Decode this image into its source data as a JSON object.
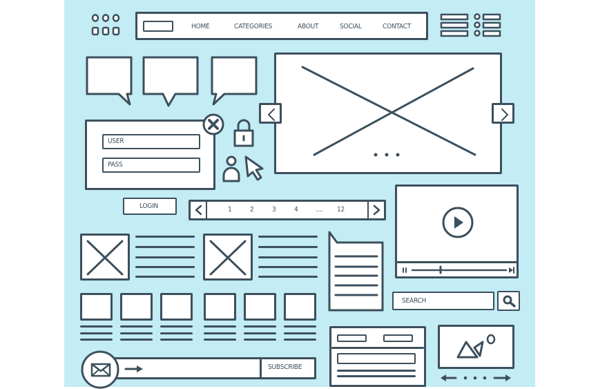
{
  "colors": {
    "background": "#c3ecf5",
    "ink": "#3c4f5c",
    "surface": "#ffffff"
  },
  "nav": {
    "items": [
      "HOME",
      "CATEGORIES",
      "ABOUT",
      "SOCIAL",
      "CONTACT"
    ]
  },
  "login": {
    "user_placeholder": "USER",
    "pass_placeholder": "PASS",
    "button_label": "LOGIN"
  },
  "pagination": {
    "pages": [
      "1",
      "2",
      "3",
      "4",
      "....",
      "12"
    ],
    "prev_icon": "chevron-left-icon",
    "next_icon": "chevron-right-icon"
  },
  "search": {
    "placeholder": "SEARCH",
    "icon": "search-icon"
  },
  "subscribe": {
    "button_label": "SUBSCRIBE",
    "icon": "envelope-icon"
  },
  "icons": [
    "dot-grid-icon",
    "list-icon",
    "close-icon",
    "lock-icon",
    "user-icon",
    "cursor-icon",
    "play-icon",
    "image-icon"
  ]
}
